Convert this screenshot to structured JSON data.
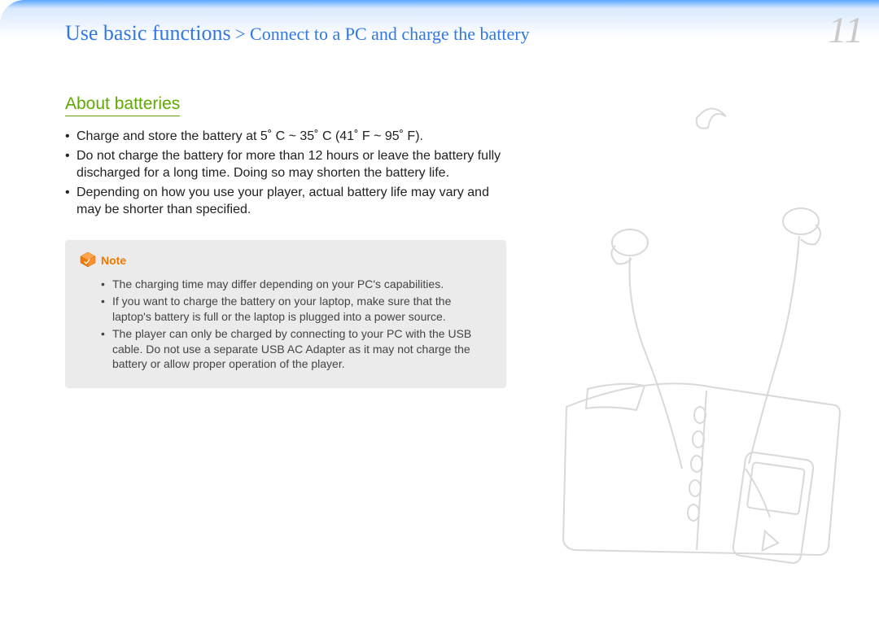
{
  "header": {
    "breadcrumb_main": "Use basic functions",
    "breadcrumb_sep": " > ",
    "breadcrumb_sub": "Connect to a PC and charge the battery",
    "page_number": "11"
  },
  "section": {
    "title": "About batteries",
    "bullets": [
      "Charge and store the battery at 5˚ C ~ 35˚ C (41˚ F ~ 95˚ F).",
      "Do not charge the battery for more than 12 hours or leave the battery fully discharged for a long time. Doing so may shorten the battery life.",
      "Depending on how you use your player, actual battery life may vary and may be shorter than specified."
    ]
  },
  "note": {
    "label": "Note",
    "bullets": [
      "The charging time may differ depending on your PC's capabilities.",
      "If you want to charge the battery on your laptop, make sure that the laptop's battery is full or the laptop is plugged into a power source.",
      "The player can only be charged by connecting to your PC with the USB cable. Do not use a separate USB AC Adapter as it may not charge the battery or allow proper operation of the player."
    ]
  },
  "illustration": {
    "name": "earbuds-planner-player-illustration"
  }
}
